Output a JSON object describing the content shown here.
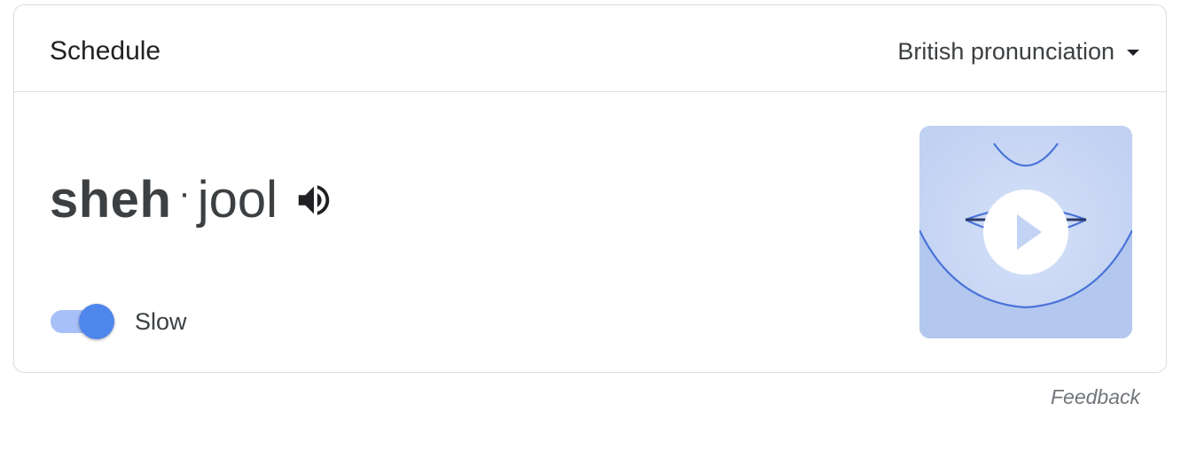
{
  "card": {
    "word": "Schedule",
    "accent": {
      "selected": "British pronunciation"
    },
    "pronunciation": {
      "stressed_syllable": "sheh",
      "separator": "·",
      "syllable_2": "jool"
    },
    "slow_toggle": {
      "label": "Slow",
      "on": true
    }
  },
  "feedback_label": "Feedback",
  "icons": {
    "speaker": "speaker-icon",
    "dropdown": "chevron-down-icon",
    "play": "play-icon"
  },
  "colors": {
    "accent_blue": "#4f86ec",
    "track_blue": "#a8c0f8",
    "video_bg": "#c3d3f3",
    "line_blue": "#4a74d9"
  }
}
